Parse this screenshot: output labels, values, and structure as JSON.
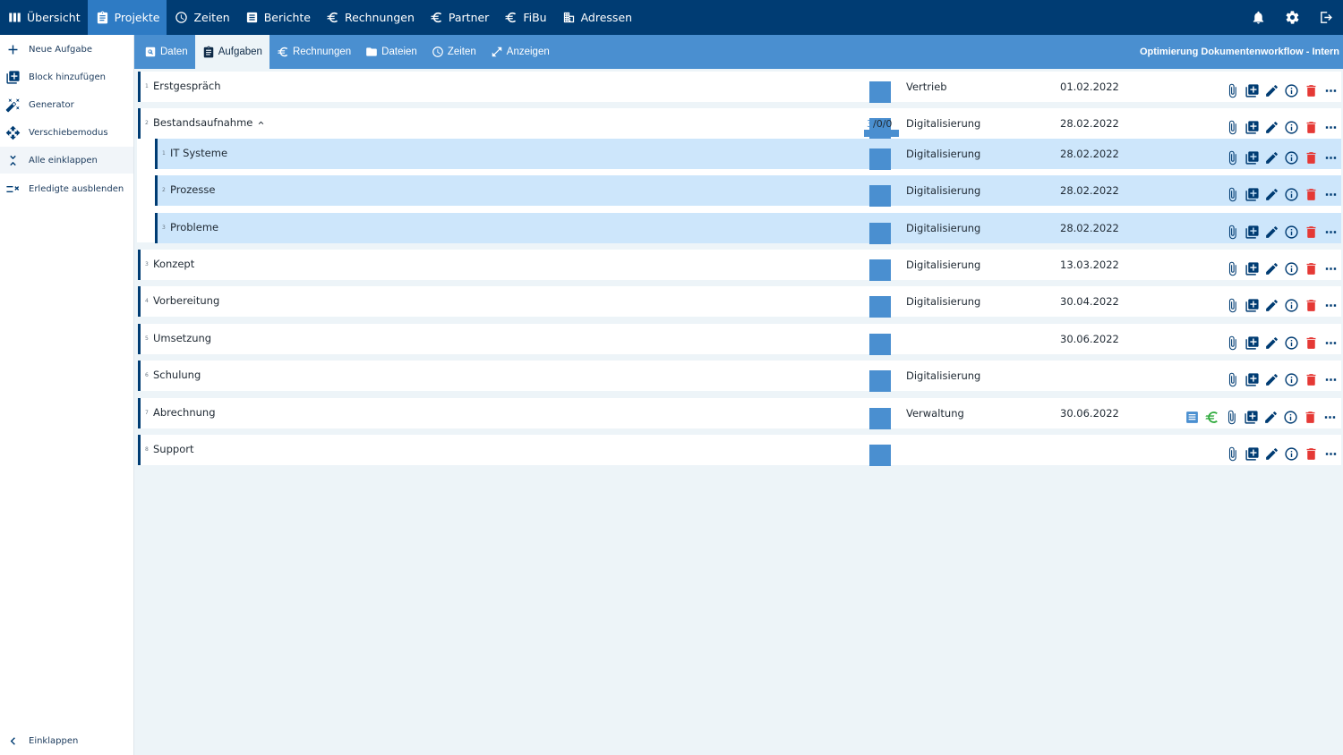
{
  "topnav": [
    {
      "label": "Übersicht",
      "icon": "columns-icon",
      "active": false
    },
    {
      "label": "Projekte",
      "icon": "clipboard-icon",
      "active": true
    },
    {
      "label": "Zeiten",
      "icon": "clock-icon",
      "active": false
    },
    {
      "label": "Berichte",
      "icon": "document-icon",
      "active": false
    },
    {
      "label": "Rechnungen",
      "icon": "euro-icon",
      "active": false
    },
    {
      "label": "Partner",
      "icon": "euro-icon",
      "active": false
    },
    {
      "label": "FiBu",
      "icon": "euro-icon",
      "active": false
    },
    {
      "label": "Adressen",
      "icon": "building-icon",
      "active": false
    }
  ],
  "topright_icons": [
    "bell-icon",
    "gear-icon",
    "logout-icon"
  ],
  "sidebar": {
    "items": [
      {
        "label": "Neue Aufgabe",
        "icon": "plus-icon"
      },
      {
        "label": "Block hinzufügen",
        "icon": "add-block-icon"
      },
      {
        "label": "Generator",
        "icon": "magic-wand-icon"
      },
      {
        "label": "Verschiebemodus",
        "icon": "move-icon"
      },
      {
        "label": "Alle einklappen",
        "icon": "collapse-all-icon"
      },
      {
        "label": "Erledigte ausblenden",
        "icon": "hide-done-icon"
      }
    ],
    "collapse_label": "Einklappen"
  },
  "subtabs": [
    {
      "label": "Daten",
      "icon": "search-doc-icon",
      "active": false
    },
    {
      "label": "Aufgaben",
      "icon": "clipboard-icon",
      "active": true
    },
    {
      "label": "Rechnungen",
      "icon": "euro-icon",
      "active": false
    },
    {
      "label": "Dateien",
      "icon": "folder-icon",
      "active": false
    },
    {
      "label": "Zeiten",
      "icon": "clock-icon",
      "active": false
    },
    {
      "label": "Anzeigen",
      "icon": "expand-icon",
      "active": false
    }
  ],
  "project_title": "Optimierung Dokumentenworkflow - Intern",
  "colors": {
    "navy": "#003c73",
    "blue": "#4a8fd0",
    "active_top": "#2e7bc4",
    "child_row": "#cde6fb",
    "delete": "#e53935",
    "money": "#2eaa3c"
  },
  "tasks": [
    {
      "num": "1",
      "name": "Erstgespräch",
      "category": "Vertrieb",
      "date": "01.02.2022",
      "extra_icons": false
    },
    {
      "num": "2",
      "name": "Bestandsaufnahme",
      "category": "Digitalisierung",
      "date": "28.02.2022",
      "expanded": true,
      "progress": {
        "a": "3",
        "rest": "/0/0"
      },
      "children": [
        {
          "num": "1",
          "name": "IT Systeme",
          "category": "Digitalisierung",
          "date": "28.02.2022"
        },
        {
          "num": "2",
          "name": "Prozesse",
          "category": "Digitalisierung",
          "date": "28.02.2022"
        },
        {
          "num": "3",
          "name": "Probleme",
          "category": "Digitalisierung",
          "date": "28.02.2022"
        }
      ]
    },
    {
      "num": "3",
      "name": "Konzept",
      "category": "Digitalisierung",
      "date": "13.03.2022",
      "extra_icons": false
    },
    {
      "num": "4",
      "name": "Vorbereitung",
      "category": "Digitalisierung",
      "date": "30.04.2022",
      "extra_icons": false
    },
    {
      "num": "5",
      "name": "Umsetzung",
      "category": "",
      "date": "30.06.2022",
      "extra_icons": false
    },
    {
      "num": "6",
      "name": "Schulung",
      "category": "Digitalisierung",
      "date": "",
      "extra_icons": false
    },
    {
      "num": "7",
      "name": "Abrechnung",
      "category": "Verwaltung",
      "date": "30.06.2022",
      "extra_icons": true
    },
    {
      "num": "8",
      "name": "Support",
      "category": "",
      "date": "",
      "extra_icons": false
    }
  ]
}
